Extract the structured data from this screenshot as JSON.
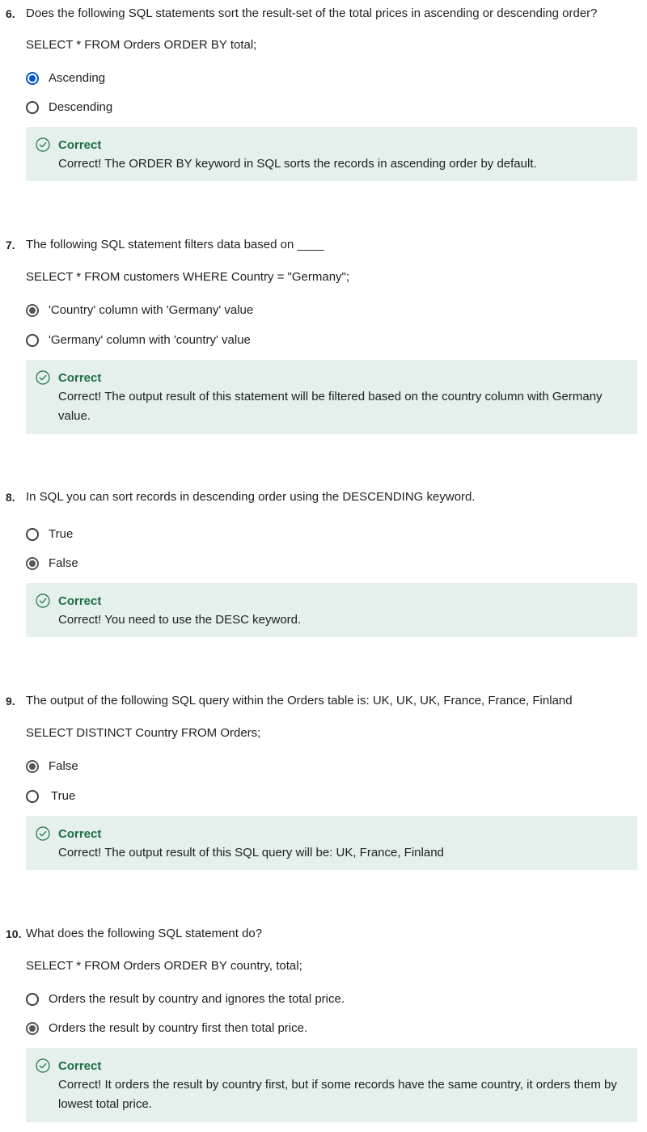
{
  "questions": [
    {
      "number": "6.",
      "text": "Does the following SQL statements sort the result-set of the total prices in ascending or descending order?",
      "code": "SELECT * FROM Orders ORDER BY total;",
      "options": [
        {
          "label": "Ascending",
          "selected": true
        },
        {
          "label": "Descending",
          "selected": false
        }
      ],
      "feedback": {
        "title": "Correct",
        "text": "Correct! The ORDER BY keyword in SQL sorts the records in ascending order by default."
      }
    },
    {
      "number": "7.",
      "text": "The following SQL statement filters data based on ____",
      "code": "SELECT * FROM customers WHERE Country = \"Germany\";",
      "options": [
        {
          "label": "'Country' column with 'Germany' value",
          "selected": true
        },
        {
          "label": "'Germany' column with 'country' value",
          "selected": false
        }
      ],
      "feedback": {
        "title": "Correct",
        "text": "Correct! The output result of this statement will be filtered based on the country column with Germany value."
      }
    },
    {
      "number": "8.",
      "text": "In SQL you can sort records in descending order using the DESCENDING keyword.",
      "code": "",
      "options": [
        {
          "label": "True",
          "selected": false
        },
        {
          "label": "False",
          "selected": true
        }
      ],
      "feedback": {
        "title": "Correct",
        "text": "Correct! You need to use the DESC keyword."
      }
    },
    {
      "number": "9.",
      "text": "The output of the following SQL query within the Orders table is: UK, UK, UK, France, France, Finland",
      "code": "SELECT DISTINCT Country FROM Orders;",
      "options": [
        {
          "label": "False",
          "selected": true
        },
        {
          "label": "True",
          "selected": false
        }
      ],
      "feedback": {
        "title": "Correct",
        "text": "Correct! The output result of this SQL query will be: UK, France, Finland"
      }
    },
    {
      "number": "10.",
      "text": "What does the following SQL statement do?",
      "code": "SELECT * FROM Orders ORDER BY country, total;",
      "options": [
        {
          "label": "Orders the result by country and ignores the total price.",
          "selected": false
        },
        {
          "label": "Orders the result by country first then total price.",
          "selected": true
        }
      ],
      "feedback": {
        "title": "Correct",
        "text": "Correct! It orders the result by country first, but if some records have the same country, it orders them by lowest total price."
      }
    }
  ],
  "colors": {
    "feedback_bg": "#e5efec",
    "correct_green": "#1f6e43",
    "selected_blue": "#0056d2",
    "selected_grey": "#555555"
  },
  "icons": {
    "feedback": "check-circle-icon"
  }
}
